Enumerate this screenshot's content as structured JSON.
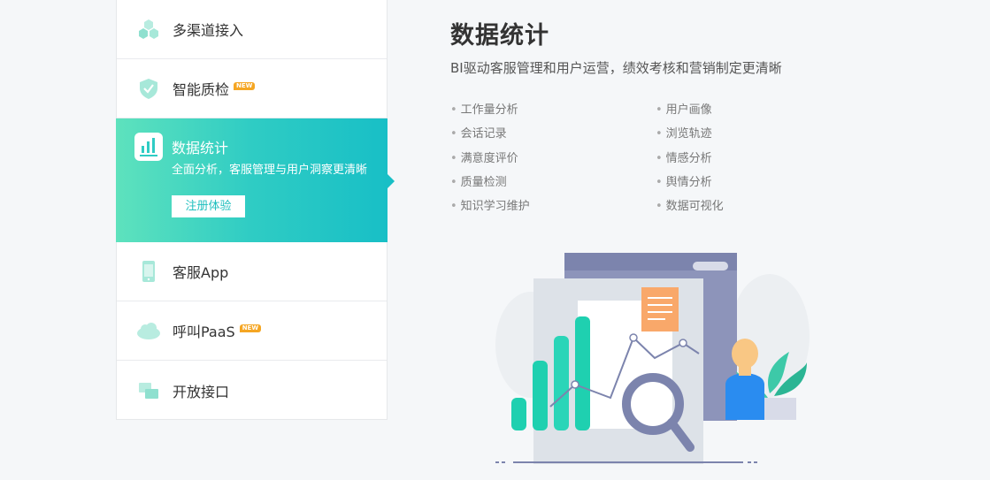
{
  "sidebar": {
    "items": [
      {
        "label": "多渠道接入",
        "icon": "hexagons-icon"
      },
      {
        "label": "智能质检",
        "icon": "shield-check-icon",
        "badge": "NEW"
      },
      {
        "label": "数据统计",
        "icon": "bar-chart-icon",
        "description": "全面分析，客服管理与用户洞察更清晰",
        "cta": "注册体验"
      },
      {
        "label": "客服App",
        "icon": "mobile-app-icon"
      },
      {
        "label": "呼叫PaaS",
        "icon": "paas-cloud-icon",
        "badge": "NEW"
      },
      {
        "label": "开放接口",
        "icon": "interface-icon"
      }
    ]
  },
  "main": {
    "title": "数据统计",
    "subtitle": "BI驱动客服管理和用户运营，绩效考核和营销制定更清晰",
    "features_left": [
      "工作量分析",
      "会话记录",
      "满意度评价",
      "质量检测",
      "知识学习维护"
    ],
    "features_right": [
      "用户画像",
      "浏览轨迹",
      "情感分析",
      "舆情分析",
      "数据可视化"
    ]
  },
  "colors": {
    "accent": "#1fbfbe",
    "gradient_start": "#5ee2bd",
    "badge": "#f5a623"
  }
}
